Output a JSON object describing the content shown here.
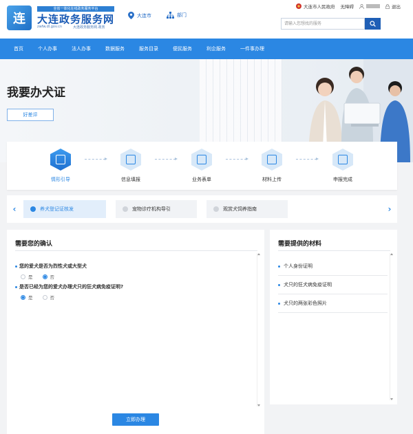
{
  "header": {
    "logo_char": "连",
    "logo_slogan": "全省一体化在线政务服务平台",
    "site_name": "大连政务服务网",
    "site_url": "zwfw.dl.gov.cn",
    "site_url_cn": "大连政务服务网.政务",
    "location": "大连市",
    "department": "部门",
    "gov_link": "大连市人民政府",
    "accessibility": "无障碍",
    "logout": "退出",
    "search_placeholder": "请输入您想找的服务"
  },
  "nav": {
    "items": [
      "首页",
      "个人办事",
      "法人办事",
      "数据服务",
      "服务目录",
      "便民服务",
      "利企服务",
      "一件事办理"
    ]
  },
  "banner": {
    "title": "我要办犬证",
    "rate_button": "好差评"
  },
  "steps": {
    "items": [
      {
        "label": "情形引导",
        "active": true,
        "icon": "guide-icon"
      },
      {
        "label": "信息填报",
        "active": false,
        "icon": "form-fill-icon"
      },
      {
        "label": "业务表单",
        "active": false,
        "icon": "document-icon"
      },
      {
        "label": "材料上传",
        "active": false,
        "icon": "upload-icon"
      },
      {
        "label": "申报完成",
        "active": false,
        "icon": "complete-icon"
      }
    ]
  },
  "tabs": {
    "items": [
      {
        "label": "养犬登记证核发",
        "active": true
      },
      {
        "label": "宠物诊疗机构导引",
        "active": false
      },
      {
        "label": "观赏犬饲养指南",
        "active": false
      }
    ]
  },
  "confirm": {
    "title": "需要您的确认",
    "questions": [
      {
        "text": "您的爱犬是否为烈性犬或大型犬",
        "options": [
          "是",
          "否"
        ],
        "selected": "否"
      },
      {
        "text": "是否已经为您的爱犬办理犬只的狂犬病免疫证明?",
        "options": [
          "是",
          "否"
        ],
        "selected": "是"
      }
    ],
    "submit_label": "立即办理"
  },
  "materials": {
    "title": "需要提供的材料",
    "items": [
      "个人身份证明",
      "犬只的狂犬病免疫证明",
      "犬只的两张彩色照片"
    ]
  },
  "colors": {
    "primary": "#2b87e3",
    "nav_bg": "#2b87e3",
    "search_button": "#1f5fb6",
    "page_bg": "#f2f3f5"
  }
}
